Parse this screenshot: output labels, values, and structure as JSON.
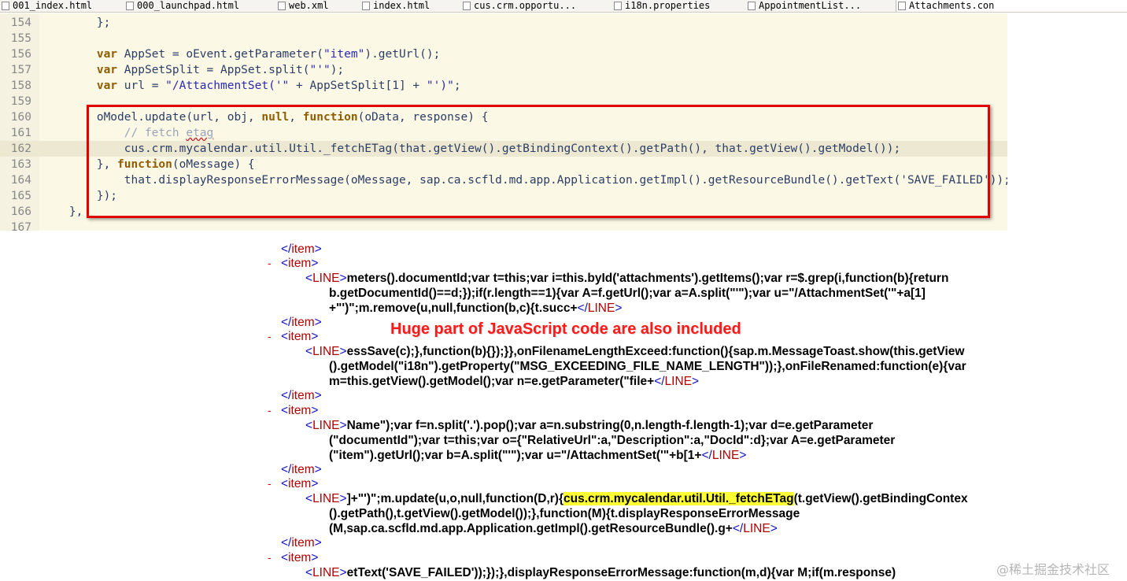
{
  "tabs": [
    {
      "label": "001_index.html",
      "icon": "html-file-icon"
    },
    {
      "label": "000_launchpad.html",
      "icon": "html-file-icon"
    },
    {
      "label": "web.xml",
      "icon": "xml-file-icon"
    },
    {
      "label": "index.html",
      "icon": "html-file-icon"
    },
    {
      "label": "cus.crm.opportu...",
      "icon": "js-file-icon"
    },
    {
      "label": "i18n.properties",
      "icon": "properties-file-icon"
    },
    {
      "label": "AppointmentList...",
      "icon": "html-file-icon"
    },
    {
      "label": "Attachments.con",
      "icon": "js-file-icon"
    }
  ],
  "editor": {
    "lines": [
      {
        "num": "154"
      },
      {
        "num": "155"
      },
      {
        "num": "156"
      },
      {
        "num": "157"
      },
      {
        "num": "158"
      },
      {
        "num": "159"
      },
      {
        "num": "160"
      },
      {
        "num": "161"
      },
      {
        "num": "162"
      },
      {
        "num": "163"
      },
      {
        "num": "164"
      },
      {
        "num": "165"
      },
      {
        "num": "166"
      },
      {
        "num": "167"
      }
    ],
    "tokens": {
      "l154": "        };",
      "l156_kw": "var",
      "l156_a": " AppSet = oEvent.getParameter(",
      "l156_s": "\"item\"",
      "l156_b": ").getUrl();",
      "l157_kw": "var",
      "l157_a": " AppSetSplit = AppSet.split(",
      "l157_s": "\"'\"",
      "l157_b": ");",
      "l158_kw": "var",
      "l158_a": " url = ",
      "l158_s1": "\"/AttachmentSet('\"",
      "l158_b": " + AppSetSplit[1] + ",
      "l158_s2": "\"')\"",
      "l158_c": ";",
      "l160_a": "oModel.update(url, obj, ",
      "l160_kw1": "null",
      "l160_b": ", ",
      "l160_kw2": "function",
      "l160_c": "(oData, response) {",
      "l161_cm": "// fetch ",
      "l161_sq": "etag",
      "l162": "cus.crm.mycalendar.util.Util._fetchETag(that.getView().getBindingContext().getPath(), that.getView().getModel());",
      "l163_a": "}, ",
      "l163_kw": "function",
      "l163_b": "(oMessage) {",
      "l164": "that.displayResponseErrorMessage(oMessage, sap.ca.scfld.md.app.Application.getImpl().getResourceBundle().getText('SAVE_FAILED'));",
      "l165": "});",
      "l166": "},"
    }
  },
  "xml": {
    "open_item": "item",
    "line_tag": "LINE",
    "blocks": [
      [
        "meters().documentId;var t=this;var i=this.byId('attachments').getItems();var r=$.grep(i,function(b){return",
        "b.getDocumentId()==d;});if(r.length==1){var A=f.getUrl();var a=A.split(\"'\");var u=\"/AttachmentSet('\"+a[1]",
        "+\"')\";m.remove(u,null,function(b,c){t.succ+"
      ],
      [
        "essSave(c);},function(b){});}},onFilenameLengthExceed:function(){sap.m.MessageToast.show(this.getView",
        "().getModel(\"i18n\").getProperty(\"MSG_EXCEEDING_FILE_NAME_LENGTH\"));},onFileRenamed:function(e){var",
        "m=this.getView().getModel();var n=e.getParameter(\"file+"
      ],
      [
        "Name\");var f=n.split('.').pop();var a=n.substring(0,n.length-f.length-1);var d=e.getParameter",
        "(\"documentId\");var t=this;var o={\"RelativeUrl\":a,\"Description\":a,\"DocId\":d};var A=e.getParameter",
        "(\"item\").getUrl();var b=A.split(\"'\");var u=\"/AttachmentSet('\"+b[1+"
      ],
      [
        "]+\"')\";m.update(u,o,null,function(D,r){",
        "().getPath(),t.getView().getModel());},function(M){t.displayResponseErrorMessage",
        "(M,sap.ca.scfld.md.app.Application.getImpl().getResourceBundle().g+"
      ],
      [
        "etText('SAVE_FAILED'));});},displayResponseErrorMessage:function(m,d){var M;if(m.response)"
      ]
    ],
    "highlight": "cus.crm.mycalendar.util.Util._fetchETag",
    "highlight_after": "(t.getView().getBindingContex",
    "minus": "-"
  },
  "annotation": "Huge part of JavaScript code are also included",
  "watermark": "@稀土掘金技术社区",
  "colors": {
    "editor_bg": "#fcf8e6",
    "keyword": "#8f5d00",
    "string": "#2a2ab0",
    "xml_tag": "#1010c8",
    "xml_tag_name": "#b00000",
    "annotation": "#ff1a1a",
    "highlight": "#ffff33",
    "redbox": "#e00000"
  }
}
